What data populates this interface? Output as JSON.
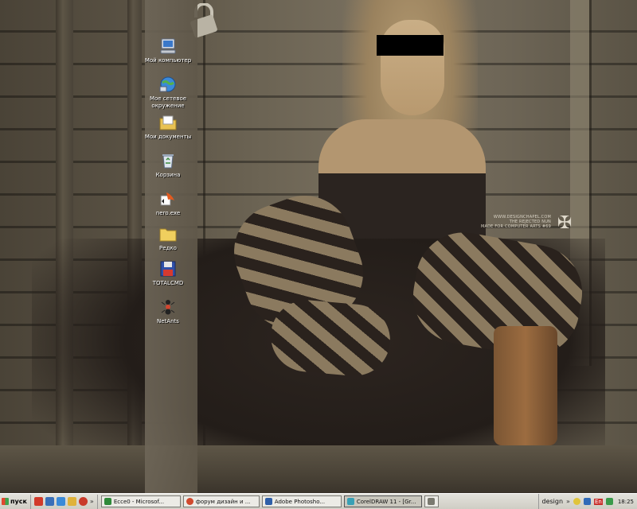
{
  "desktop": {
    "icons": [
      {
        "label": "Мой компьютер",
        "icon": "my-computer-icon"
      },
      {
        "label": "Мое сетевое окружение",
        "icon": "network-places-icon"
      },
      {
        "label": "Мои документы",
        "icon": "my-documents-icon"
      },
      {
        "label": "Корзина",
        "icon": "recycle-bin-icon"
      },
      {
        "label": "nero.exe",
        "icon": "nero-icon"
      },
      {
        "label": "Редко",
        "icon": "folder-icon"
      },
      {
        "label": "TOTALCMD",
        "icon": "totalcmd-icon"
      },
      {
        "label": "NetAnts",
        "icon": "netants-icon"
      }
    ],
    "wallpaper_watermark": {
      "line1": "WWW.DESIGNCHAPEL.COM",
      "line2": "THE REJECTED NUN",
      "line3": "MADE FOR COMPUTER ARTS #69"
    }
  },
  "taskbar": {
    "start_label": "пуск",
    "tasks": [
      {
        "label": "Ecce0 - Microsof...",
        "icon_color": "#2f8a3a",
        "active": false
      },
      {
        "label": "форум дизайн и ...",
        "icon_color": "#d0492e",
        "active": false
      },
      {
        "label": "Adobe Photosho...",
        "icon_color": "#2f5fa8",
        "active": false
      },
      {
        "label": "CorelDRAW 11 - [Gr...",
        "icon_color": "#39a0b5",
        "active": true
      }
    ],
    "tray": {
      "toolbar_label": "design",
      "language": "En",
      "clock": "18:25"
    }
  },
  "colors": {
    "taskbar_bg": "#d6d4cb",
    "selection": "#2b4d9c"
  }
}
